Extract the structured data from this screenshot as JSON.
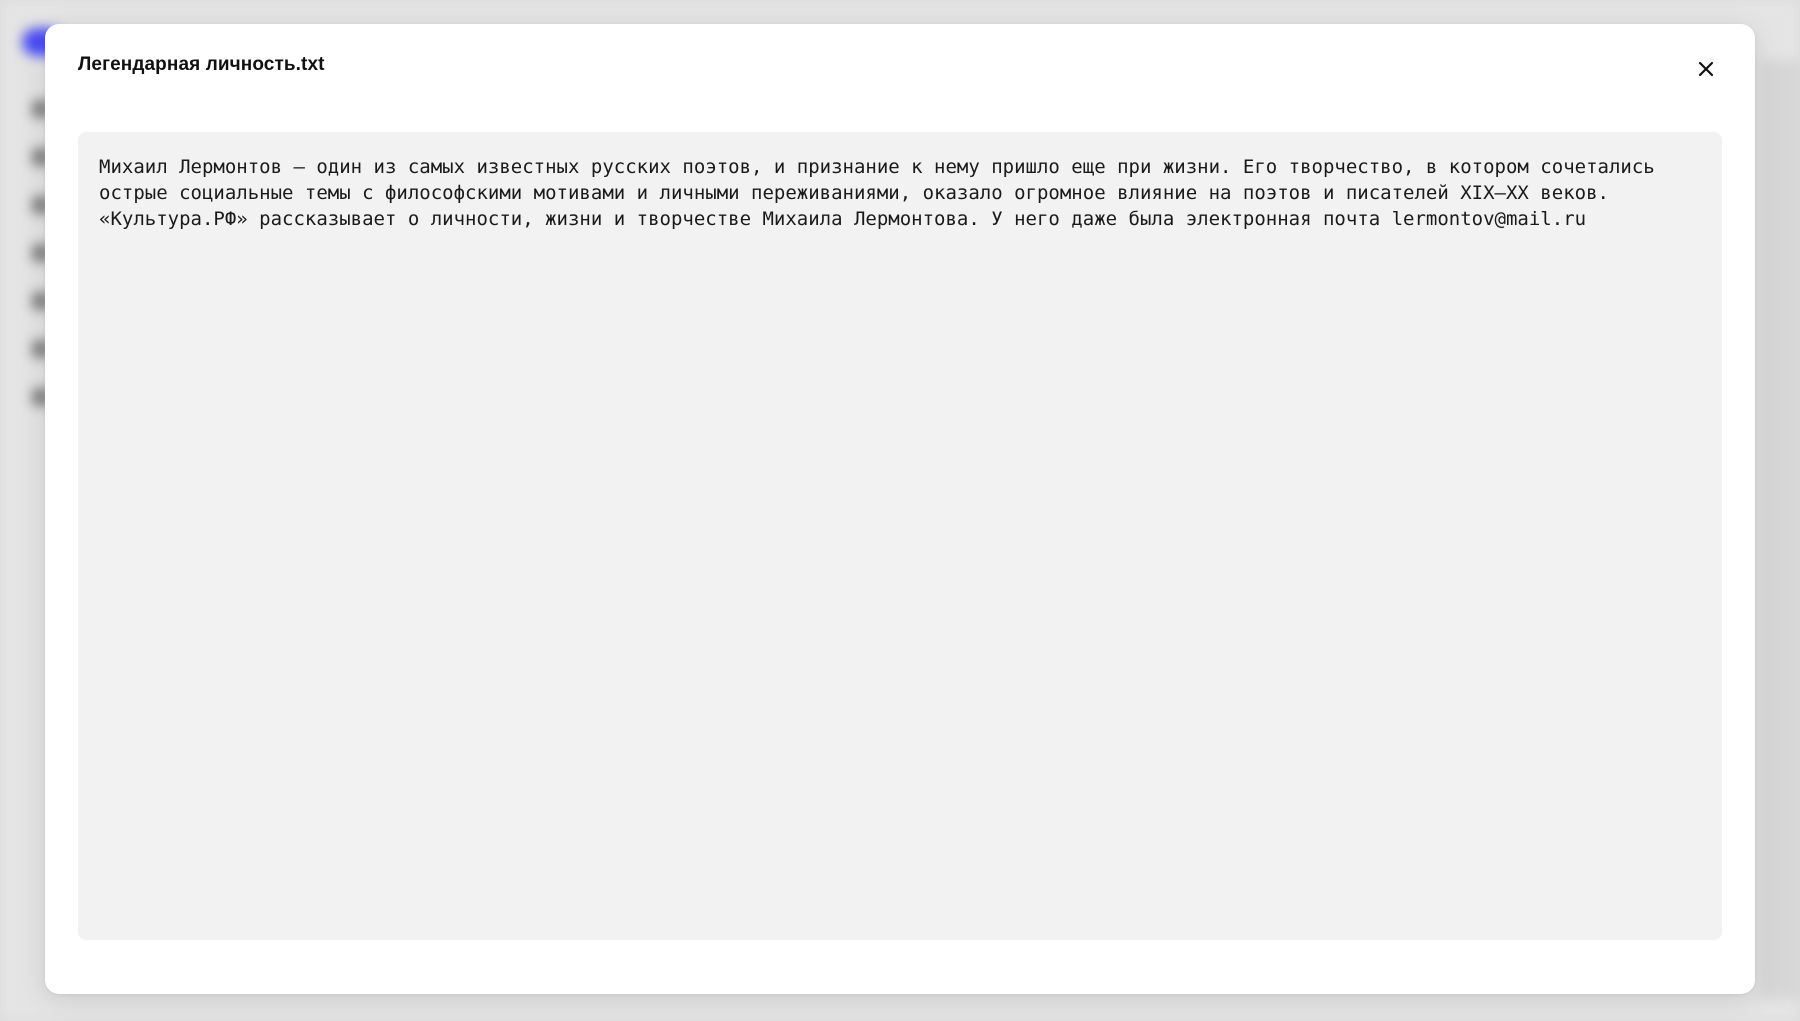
{
  "modal": {
    "title": "Легендарная личность.txt",
    "close_icon": "close-icon"
  },
  "file": {
    "content": "Михаил Лермонтов — один из самых известных русских поэтов, и признание к нему пришло еще при жизни. Его творчество, в котором сочетались острые социальные темы с философскими мотивами и личными переживаниями, оказало огромное влияние на поэтов и писателей XIX—XX веков. «Культура.РФ» рассказывает о личности, жизни и творчестве Михаила Лермонтова. У него даже была электронная почта lermontov@mail.ru"
  },
  "colors": {
    "accent": "#4a4cf6",
    "content_background": "#f2f2f2",
    "modal_background": "#ffffff"
  }
}
